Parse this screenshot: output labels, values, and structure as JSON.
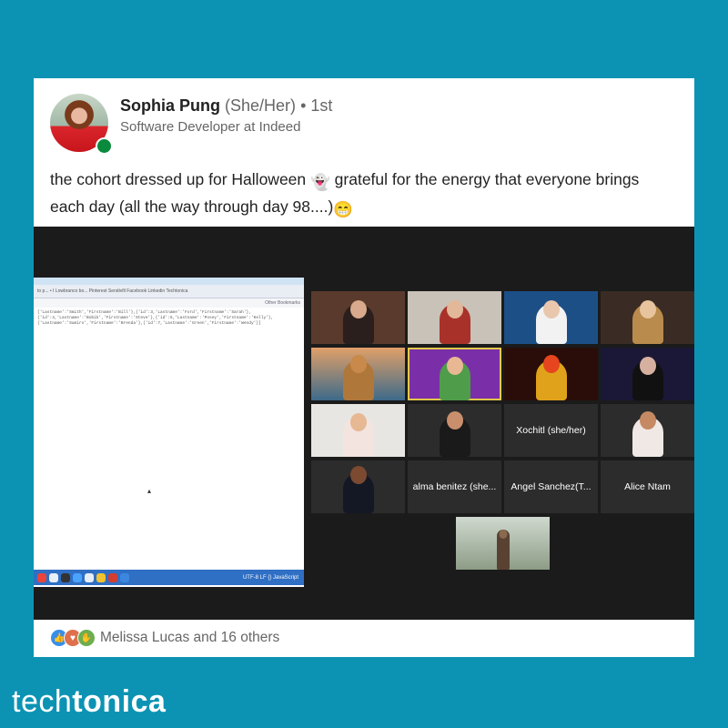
{
  "post": {
    "author_name": "Sophia Pung",
    "author_pronouns": "(She/Her)",
    "connection_degree": "• 1st",
    "author_headline": "Software Developer at Indeed",
    "text_part1": "the cohort dressed up for Halloween ",
    "ghost_emoji": "👻",
    "text_part2": " grateful for the energy that everyone brings each day (all the way through day 98....)",
    "grin_emoji": "😁"
  },
  "shared_screen": {
    "tab_text": "to p...    • I Lowbranco bo...    Pinterest    Sendivfil    Facebook    Linkedin    Techtonica",
    "bookmark_text": "Other Bookmarks",
    "code_lines": [
      "['Lastname':'Smith','Firstname':'Bill'},{'id':3,'Lastname':'Ford','Firstname':'Sarah'},",
      "{'id':4,'Lastname':'Bobik','Firstname':'Steve'},{'id':5,'Lastname':'Posey','Firstname':'Kelly'},",
      "{'Lastname':'Sumiro','Firstname':'Brenda'},{'id':7,'Lastname':'Green','Firstname':'Wendy'}]"
    ],
    "status_text": "UTF-8   LF   {} JavaScript"
  },
  "gallery": {
    "name_tiles": [
      "Xochitl (she/her)",
      "alma benitez (she...",
      "Angel Sanchez(T...",
      "Alice Ntam"
    ]
  },
  "reactions": {
    "summary": "Melissa Lucas and 16 others",
    "icons": [
      "like-icon",
      "love-icon",
      "support-icon"
    ]
  },
  "brand": {
    "part1": "tech",
    "part2": "tonica"
  },
  "colors": {
    "background": "#0c93b4",
    "presence": "#0a8a3c",
    "active_speaker_border": "#e3c94a"
  }
}
